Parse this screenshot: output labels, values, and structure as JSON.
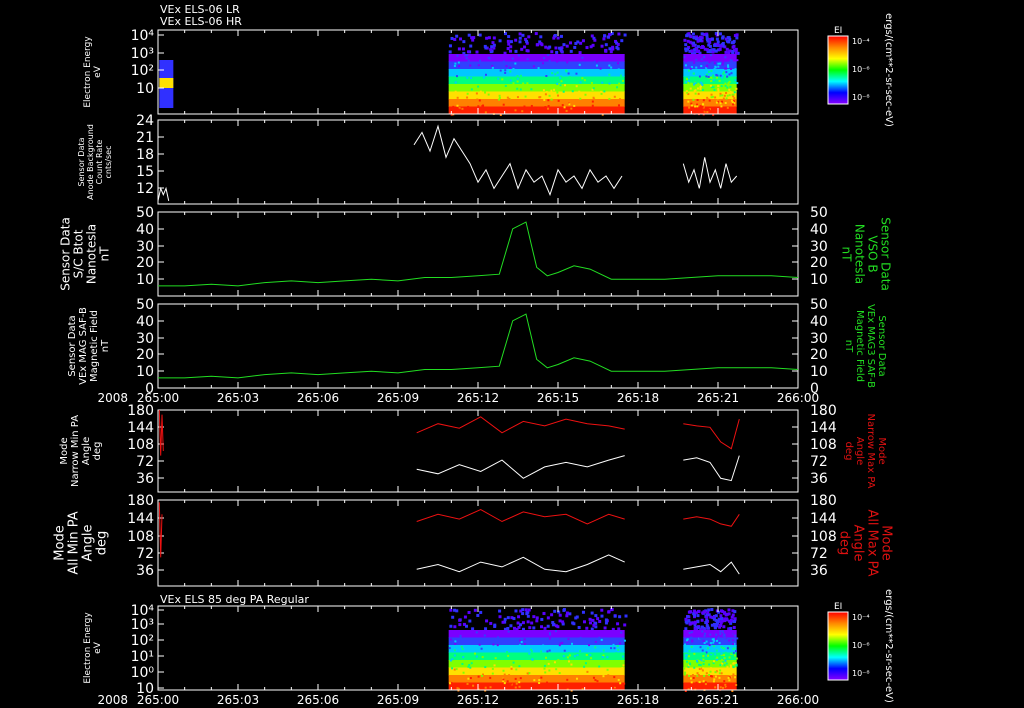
{
  "header": {
    "line1": "VEx ELS-06 LR",
    "line2": "VEx ELS-06 HR"
  },
  "time_axis": {
    "year": "2008",
    "ticks": [
      "265:00",
      "265:03",
      "265:06",
      "265:09",
      "265:12",
      "265:15",
      "265:18",
      "265:21",
      "266:00"
    ],
    "range_hours": [
      0,
      24
    ]
  },
  "colors": {
    "background": "#000000",
    "axes": "#ffffff",
    "green_trace": "#22dd22",
    "red_trace": "#ee1111",
    "white_trace": "#ffffff",
    "green_label": "#22dd22",
    "red_label": "#dd1111"
  },
  "colorbars": {
    "label": "EI",
    "ticks": [
      "10⁻⁴",
      "10⁻⁶",
      "10⁻⁸"
    ],
    "unit_label": "ergs/(cm**2-sr-sec-eV)",
    "stops": [
      "#ff0000",
      "#ff8800",
      "#ffff00",
      "#00ff00",
      "#00ffff",
      "#0000ff",
      "#8800ff"
    ]
  },
  "panels": {
    "p1": {
      "ylabel": [
        "Electron Energy",
        "eV"
      ],
      "yticks": [
        "10⁴",
        "10³",
        "10²",
        "10"
      ]
    },
    "p2": {
      "ylabel": [
        "Sensor Data",
        "Anode Background",
        "Count Rate",
        "cnts/sec"
      ],
      "yticks": [
        "24",
        "21",
        "18",
        "15",
        "12"
      ]
    },
    "p3": {
      "ylabel": [
        "Sensor Data",
        "S/C Btot",
        "Nanotesla",
        "nT"
      ],
      "ylabel_right": [
        "Sensor Data",
        "VSO B",
        "Nanotesla",
        "nT"
      ],
      "yticks": [
        "50",
        "40",
        "30",
        "20",
        "10"
      ]
    },
    "p4": {
      "ylabel": [
        "Sensor Data",
        "VEx MAG SAF-B",
        "Magnetic Field",
        "nT"
      ],
      "ylabel_right": [
        "Sensor Data",
        "VEx MAG3 SAF-B",
        "Magnetic Field",
        "nT"
      ],
      "yticks": [
        "50",
        "40",
        "30",
        "20",
        "10",
        "0"
      ]
    },
    "p5": {
      "ylabel": [
        "Mode",
        "Narrow Min PA",
        "Angle",
        "deg"
      ],
      "ylabel_right": [
        "Mode",
        "Narrow Max PA",
        "Angle",
        "deg"
      ],
      "yticks": [
        "180",
        "144",
        "108",
        "72",
        "36"
      ]
    },
    "p6": {
      "ylabel": [
        "Mode",
        "All Min PA",
        "Angle",
        "deg"
      ],
      "ylabel_right": [
        "Mode",
        "All Max PA",
        "Angle",
        "deg"
      ],
      "yticks": [
        "180",
        "144",
        "108",
        "72",
        "36"
      ]
    },
    "p7": {
      "title": "VEx ELS 85 deg PA Regular",
      "ylabel": [
        "Electron Energy",
        "eV"
      ],
      "yticks": [
        "10⁴",
        "10³",
        "10²",
        "10¹",
        "10⁰",
        "10"
      ]
    }
  },
  "chart_data": [
    {
      "type": "heatmap",
      "title": "VEx ELS-06 LR / VEx ELS-06 HR",
      "ylabel": "Electron Energy eV",
      "yscale": "log",
      "data_intervals_hours": [
        [
          10.9,
          17.5
        ],
        [
          19.7,
          21.7
        ]
      ],
      "note_intervals": [
        [
          0.05,
          0.25
        ]
      ]
    },
    {
      "type": "line",
      "ylabel": "Sensor Data Anode Background Count Rate cnts/sec",
      "ylim": [
        10.5,
        24
      ],
      "series": [
        {
          "x": [
            0.0,
            0.1,
            0.2,
            0.3,
            0.4
          ],
          "y": [
            11,
            13,
            12,
            13,
            11
          ]
        },
        {
          "x": [
            9.6,
            9.9,
            10.2,
            10.5,
            10.8,
            11.1,
            11.4,
            11.7,
            12.0,
            12.3,
            12.6,
            12.9,
            13.2,
            13.5,
            13.8,
            14.1,
            14.4,
            14.7,
            15.0,
            15.3,
            15.6,
            15.9,
            16.2,
            16.5,
            16.8,
            17.1,
            17.4
          ],
          "y": [
            20,
            22,
            19,
            23,
            18,
            21,
            19,
            17,
            14,
            16,
            13,
            15,
            17,
            13,
            16,
            14,
            15,
            12,
            16,
            14,
            15,
            13,
            16,
            14,
            15,
            13,
            15
          ]
        },
        {
          "x": [
            19.7,
            19.9,
            20.1,
            20.3,
            20.5,
            20.7,
            20.9,
            21.1,
            21.3,
            21.5,
            21.7
          ],
          "y": [
            17,
            14,
            16,
            13,
            18,
            14,
            16,
            13,
            17,
            14,
            15
          ]
        }
      ]
    },
    {
      "type": "line",
      "ylabel": "Sensor Data S/C Btot Nanotesla nT",
      "ylim": [
        0,
        50
      ],
      "series": [
        {
          "x": [
            0,
            1,
            2,
            3,
            4,
            5,
            6,
            7,
            8,
            9,
            10,
            11,
            12,
            12.8,
            13.3,
            13.8,
            14.2,
            14.6,
            15.0,
            15.6,
            16.2,
            17.0,
            18,
            19,
            20,
            21,
            22,
            23,
            24
          ],
          "y": [
            6,
            6,
            7,
            6,
            8,
            9,
            8,
            9,
            10,
            9,
            11,
            11,
            12,
            13,
            40,
            44,
            17,
            12,
            14,
            18,
            16,
            10,
            10,
            10,
            11,
            12,
            12,
            12,
            11
          ]
        }
      ]
    },
    {
      "type": "line",
      "ylabel": "Sensor Data VEx MAG SAF-B Magnetic Field nT",
      "ylim": [
        0,
        50
      ],
      "series": [
        {
          "x": [
            0,
            1,
            2,
            3,
            4,
            5,
            6,
            7,
            8,
            9,
            10,
            11,
            12,
            12.8,
            13.3,
            13.8,
            14.2,
            14.6,
            15.0,
            15.6,
            16.2,
            17.0,
            18,
            19,
            20,
            21,
            22,
            23,
            24
          ],
          "y": [
            6,
            6,
            7,
            6,
            8,
            9,
            8,
            9,
            10,
            9,
            11,
            11,
            12,
            13,
            40,
            44,
            17,
            12,
            14,
            18,
            16,
            10,
            10,
            10,
            11,
            12,
            12,
            12,
            11
          ]
        }
      ]
    },
    {
      "type": "line",
      "ylabel": "Mode Narrow Min PA Angle deg",
      "ylim": [
        0,
        180
      ],
      "series": [
        {
          "name": "Max PA",
          "x": [
            0.05,
            0.1,
            0.15,
            0.2,
            9.7,
            10.5,
            11.3,
            12.1,
            12.9,
            13.7,
            14.5,
            15.3,
            16.1,
            16.9,
            17.5,
            19.7,
            20.2,
            20.7,
            21.1,
            21.5,
            21.8
          ],
          "y": [
            180,
            80,
            170,
            90,
            130,
            150,
            140,
            165,
            130,
            155,
            145,
            160,
            150,
            145,
            138,
            150,
            145,
            142,
            110,
            95,
            160
          ]
        },
        {
          "name": "Min PA",
          "x": [
            9.7,
            10.5,
            11.3,
            12.1,
            12.9,
            13.7,
            14.5,
            15.3,
            16.1,
            16.9,
            17.5,
            19.7,
            20.2,
            20.7,
            21.1,
            21.5,
            21.8
          ],
          "y": [
            50,
            40,
            60,
            45,
            70,
            30,
            55,
            65,
            55,
            70,
            80,
            70,
            75,
            65,
            30,
            25,
            80
          ]
        }
      ]
    },
    {
      "type": "line",
      "ylabel": "Mode All Min PA Angle deg",
      "ylim": [
        0,
        180
      ],
      "series": [
        {
          "name": "Max PA",
          "x": [
            0.05,
            0.1,
            0.15,
            9.7,
            10.5,
            11.3,
            12.1,
            12.9,
            13.7,
            14.5,
            15.3,
            16.1,
            16.9,
            17.5,
            19.7,
            20.2,
            20.7,
            21.1,
            21.5,
            21.8
          ],
          "y": [
            175,
            60,
            150,
            135,
            150,
            140,
            160,
            135,
            155,
            145,
            150,
            130,
            150,
            140,
            140,
            145,
            140,
            130,
            125,
            150
          ]
        },
        {
          "name": "Min PA",
          "x": [
            9.7,
            10.5,
            11.3,
            12.1,
            12.9,
            13.7,
            14.5,
            15.3,
            16.1,
            16.9,
            17.5,
            19.7,
            20.2,
            20.7,
            21.1,
            21.5,
            21.8
          ],
          "y": [
            35,
            45,
            30,
            50,
            40,
            60,
            35,
            30,
            45,
            65,
            50,
            35,
            40,
            45,
            30,
            50,
            25
          ]
        }
      ]
    },
    {
      "type": "heatmap",
      "title": "VEx ELS 85 deg PA Regular",
      "ylabel": "Electron Energy eV",
      "yscale": "log",
      "data_intervals_hours": [
        [
          10.9,
          17.5
        ],
        [
          19.7,
          21.7
        ]
      ]
    }
  ]
}
